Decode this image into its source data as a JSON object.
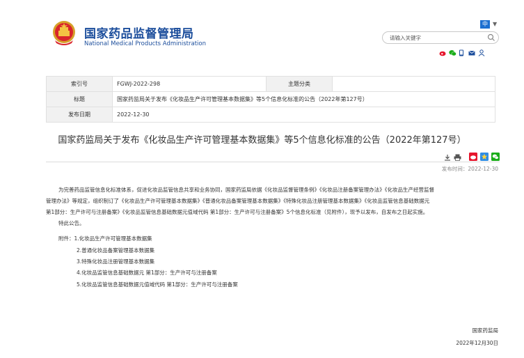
{
  "header": {
    "site_name_cn": "国家药品监督管理局",
    "site_name_en": "National Medical Products Administration",
    "lang_label": "中",
    "search_placeholder": "请输入关键字"
  },
  "info": {
    "index_label": "索引号",
    "index_value": "FGWJ-2022-298",
    "topic_label": "主题分类",
    "topic_value": "",
    "title_label": "标题",
    "title_value": "国家药监局关于发布《化妆品生产许可管理基本数据集》等5个信息化标准的公告（2022年第127号）",
    "date_label": "发布日期",
    "date_value": "2022-12-30"
  },
  "article": {
    "title": "国家药监局关于发布《化妆品生产许可管理基本数据集》等5个信息化标准的公告（2022年第127号）",
    "publish_time": "发布时间：2022-12-30",
    "para1_line1": "为完善药品监管信息化标准体系，促进化妆品监管信息共享和业务协同，国家药监局依据《化妆品监督管理条例》《化妆品注册备案管理办法》《化妆品生产经营监督",
    "para1_line2": "管理办法》等规定，组织制订了《化妆品生产许可管理基本数据集》《普通化妆品备案管理基本数据集》《特殊化妆品注册管理基本数据集》《化妆品监管信息基础数据元",
    "para1_line3": "第1部分：生产许可与注册备案》《化妆品监管信息基础数据元值域代码 第1部分：生产许可与注册备案》5个信息化标准（见附件），现予以发布，自发布之日起实施。",
    "para2": "特此公告。",
    "attachments": [
      "附件：1.化妆品生产许可管理基本数据集",
      "2.普通化妆品备案管理基本数据集",
      "3.特殊化妆品注册管理基本数据集",
      "4.化妆品监管信息基础数据元 第1部分：生产许可与注册备案",
      "5.化妆品监管信息基础数据元值域代码 第1部分：生产许可与注册备案"
    ],
    "signer": "国家药监局",
    "sign_date": "2022年12月30日"
  },
  "colors": {
    "brand_blue": "#1c4e9c",
    "accent_blue": "#1c6fd0",
    "label_bg": "#f1f1f1"
  }
}
